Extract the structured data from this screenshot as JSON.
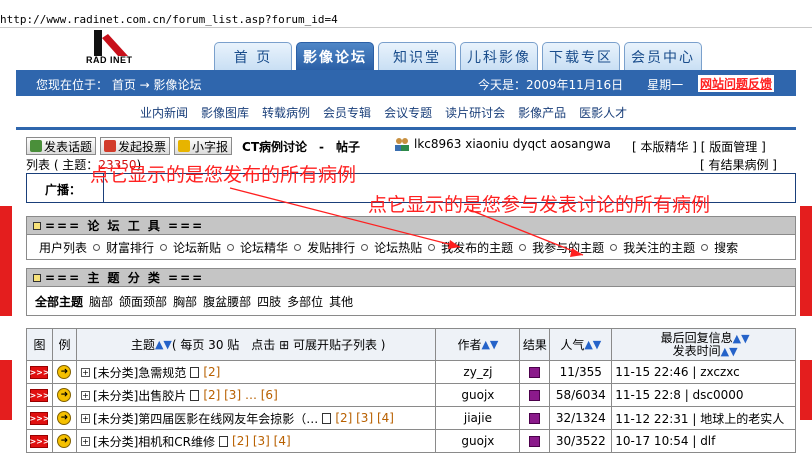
{
  "browser": {
    "url": "http://www.radinet.com.cn/forum_list.asp?forum_id=4"
  },
  "logo": {
    "text": "RAD INET"
  },
  "tabs": [
    {
      "label": "首 页"
    },
    {
      "label": "影像论坛",
      "active": true
    },
    {
      "label": "知识堂"
    },
    {
      "label": "儿科影像"
    },
    {
      "label": "下载专区"
    },
    {
      "label": "会员中心"
    }
  ],
  "bluebar": {
    "location": "您现在位于： 首页 → 影像论坛",
    "date": "今天是：2009年11月16日　　星期一",
    "feedback": "网站问题反馈"
  },
  "subnav": [
    "业内新闻",
    "影像图库",
    "转载病例",
    "会员专辑",
    "会议专题",
    "读片研讨会",
    "影像产品",
    "医影人才"
  ],
  "toolbar": {
    "post": "发表话题",
    "vote": "发起投票",
    "small": "小字报",
    "forum": "CT病例讨论　-　帖子"
  },
  "moderators": "lkc8963 xiaoniu dyqct aosangwa",
  "admin_links": "[ 本版精华 ] [ 版面管理 ]",
  "list_label": {
    "prefix": "列表 ( 主题：",
    "count": "23350",
    "suffix": ")"
  },
  "results_link": "[ 有结果病例 ]",
  "ad_label": "广播：",
  "tools": {
    "title": "=== 论 坛 工 具 ===",
    "items": [
      "用户列表",
      "财富排行",
      "论坛新贴",
      "论坛精华",
      "发贴排行",
      "论坛热贴",
      "我发布的主题",
      "我参与的主题",
      "我关注的主题",
      "搜索"
    ]
  },
  "categories": {
    "title": "=== 主 题 分 类 ===",
    "items": [
      "全部主题",
      "脑部",
      "颌面颈部",
      "胸部",
      "腹盆腰部",
      "四肢",
      "多部位",
      "其他"
    ]
  },
  "table": {
    "headers": {
      "icon": "图",
      "example": "例",
      "topic": "主题",
      "topic_note": "( 每页 30 贴　点击 ⊞ 可展开贴子列表 )",
      "author": "作者",
      "result": "结果",
      "popularity": "人气",
      "last_reply": "最后回复信息",
      "post_time": "发表时间"
    },
    "rows": [
      {
        "title": "[未分类]急需规范",
        "pages": "[2]",
        "author": "zy_zj",
        "popularity": "11/355",
        "last": "11-15 22:46 | zxczxc"
      },
      {
        "title": "[未分类]出售胶片",
        "pages": "[2] [3] … [6]",
        "author": "guojx",
        "popularity": "58/6034",
        "last": "11-15 22:8 | dsc0000"
      },
      {
        "title": "[未分类]第四届医影在线网友年会掠影（…",
        "pages": "[2] [3] [4]",
        "author": "jiajie",
        "popularity": "32/1324",
        "last": "11-12 22:31 | 地球上的老实人"
      },
      {
        "title": "[未分类]相机和CR维修",
        "pages": "[2] [3] [4]",
        "author": "guojx",
        "popularity": "30/3522",
        "last": "10-17 10:54 | dlf"
      }
    ]
  },
  "annotations": {
    "note1": "点它显示的是您发布的所有病例",
    "note2": "点它显示的是您参与发表讨论的所有病例"
  },
  "colors": {
    "brand_blue": "#2f66ad",
    "annotation_red": "#ff2020"
  }
}
